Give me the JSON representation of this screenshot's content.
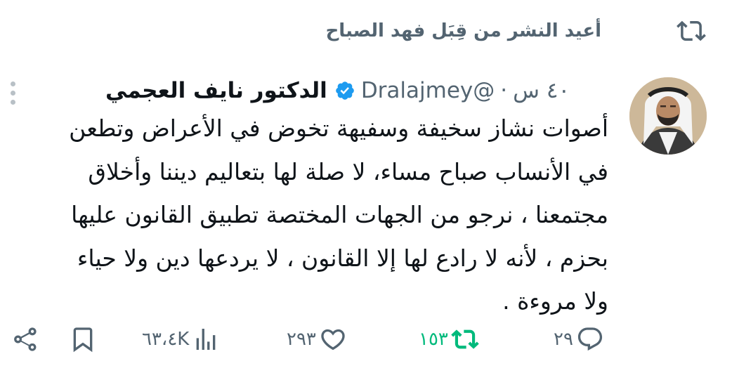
{
  "retweet_banner": {
    "icon": "retweet-icon",
    "text": "أعيد النشر من قِبَل فهد الصباح"
  },
  "tweet": {
    "author_name": "الدكتور نايف العجمي",
    "verified": true,
    "handle": "@Dralajmey",
    "separator": "·",
    "time": "٤٠ س",
    "lines": [
      "أصوات نشاز سخيفة وسفيهة تخوض في الأعراض وتطعن",
      "في الأنساب صباح مساء، لا صلة لها بتعاليم ديننا وأخلاق",
      "مجتمعنا ، نرجو من الجهات المختصة تطبيق القانون عليها",
      "بحزم ، لأنه لا رادع لها إلا القانون ، لا يردعها دين ولا حياء",
      "ولا مروءة ."
    ]
  },
  "actions": {
    "reply_count": "٢٩",
    "retweet_count": "١٥٣",
    "like_count": "٢٩٣",
    "views_count": "٦٣،٤K",
    "icons": [
      "reply-icon",
      "retweet-icon",
      "like-icon",
      "views-icon",
      "bookmark-icon",
      "share-icon"
    ]
  },
  "colors": {
    "text_primary": "#0f1419",
    "text_secondary": "#536471",
    "verified_blue": "#1d9bf0",
    "retweet_green": "#00ba7c"
  }
}
